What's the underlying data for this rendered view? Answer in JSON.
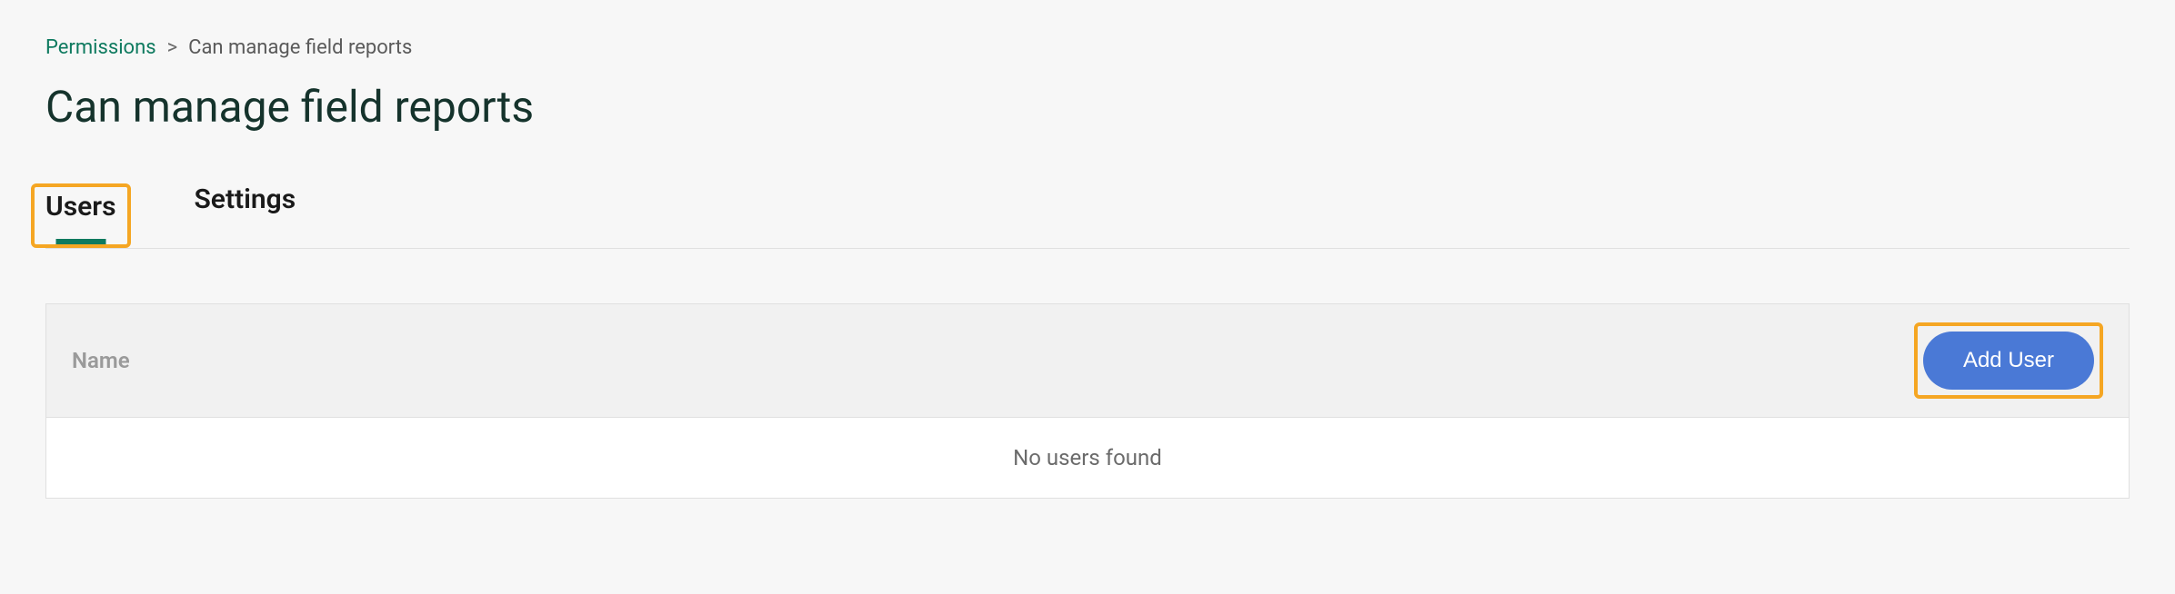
{
  "breadcrumb": {
    "root": "Permissions",
    "separator": ">",
    "current": "Can manage field reports"
  },
  "page_title": "Can manage field reports",
  "tabs": {
    "users": "Users",
    "settings": "Settings"
  },
  "table": {
    "header_name": "Name",
    "add_user_label": "Add User",
    "empty_message": "No users found"
  }
}
